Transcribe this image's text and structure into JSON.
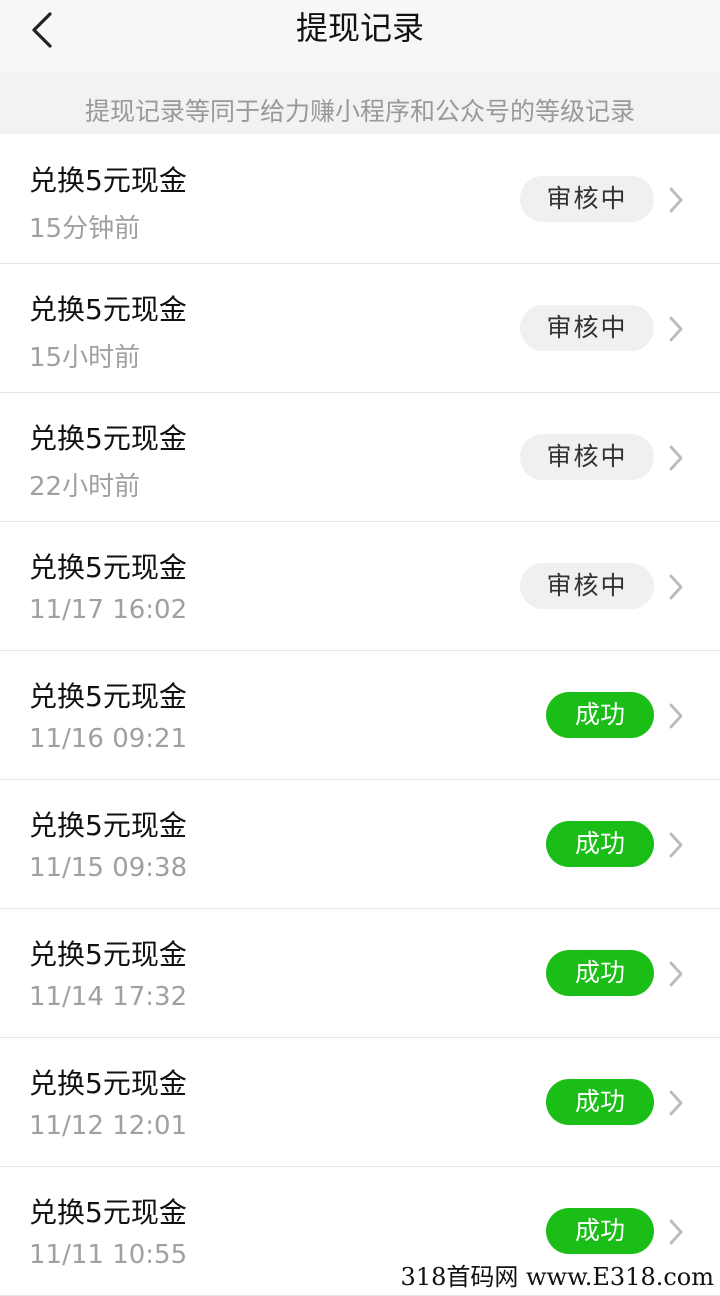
{
  "header": {
    "title": "提现记录",
    "back_icon": "chevron-left-icon"
  },
  "notice": "提现记录等同于给力赚小程序和公众号的等级记录",
  "colors": {
    "success": "#1bbd17",
    "pending_bg": "#f0f0f0",
    "muted_text": "#a0a0a0"
  },
  "records": [
    {
      "title": "兑换5元现金",
      "time": "15分钟前",
      "status": "审核中",
      "status_type": "pending"
    },
    {
      "title": "兑换5元现金",
      "time": "15小时前",
      "status": "审核中",
      "status_type": "pending"
    },
    {
      "title": "兑换5元现金",
      "time": "22小时前",
      "status": "审核中",
      "status_type": "pending"
    },
    {
      "title": "兑换5元现金",
      "time": "11/17 16:02",
      "status": "审核中",
      "status_type": "pending"
    },
    {
      "title": "兑换5元现金",
      "time": "11/16 09:21",
      "status": "成功",
      "status_type": "success"
    },
    {
      "title": "兑换5元现金",
      "time": "11/15 09:38",
      "status": "成功",
      "status_type": "success"
    },
    {
      "title": "兑换5元现金",
      "time": "11/14 17:32",
      "status": "成功",
      "status_type": "success"
    },
    {
      "title": "兑换5元现金",
      "time": "11/12 12:01",
      "status": "成功",
      "status_type": "success"
    },
    {
      "title": "兑换5元现金",
      "time": "11/11 10:55",
      "status": "成功",
      "status_type": "success"
    }
  ],
  "watermark": "318首码网 www.E318.com"
}
